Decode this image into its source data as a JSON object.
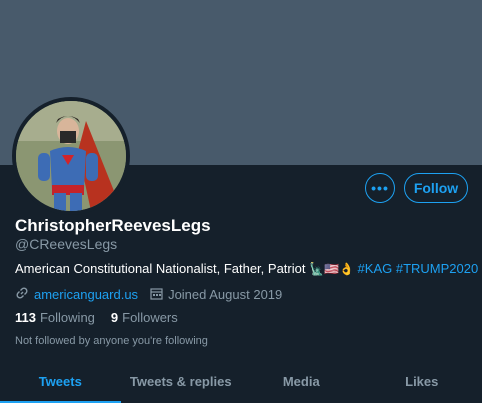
{
  "profile": {
    "display_name": "ChristopherReevesLegs",
    "handle": "@CReevesLegs",
    "bio_text": "American Constitutional Nationalist, Father, Patriot",
    "bio_emojis": "🗽🇺🇸👌",
    "bio_hashtags": [
      "#KAG",
      "#TRUMP2020"
    ],
    "website": "americanguard.us",
    "joined": "Joined August 2019",
    "following_count": "113",
    "following_label": "Following",
    "followers_count": "9",
    "followers_label": "Followers",
    "not_followed_note": "Not followed by anyone you're following"
  },
  "actions": {
    "more_label": "•••",
    "follow_label": "Follow"
  },
  "tabs": [
    {
      "label": "Tweets",
      "active": true
    },
    {
      "label": "Tweets & replies",
      "active": false
    },
    {
      "label": "Media",
      "active": false
    },
    {
      "label": "Likes",
      "active": false
    }
  ],
  "colors": {
    "background": "#15202b",
    "banner": "#485a6b",
    "accent": "#1da1f2",
    "secondary_text": "#8899a6"
  }
}
